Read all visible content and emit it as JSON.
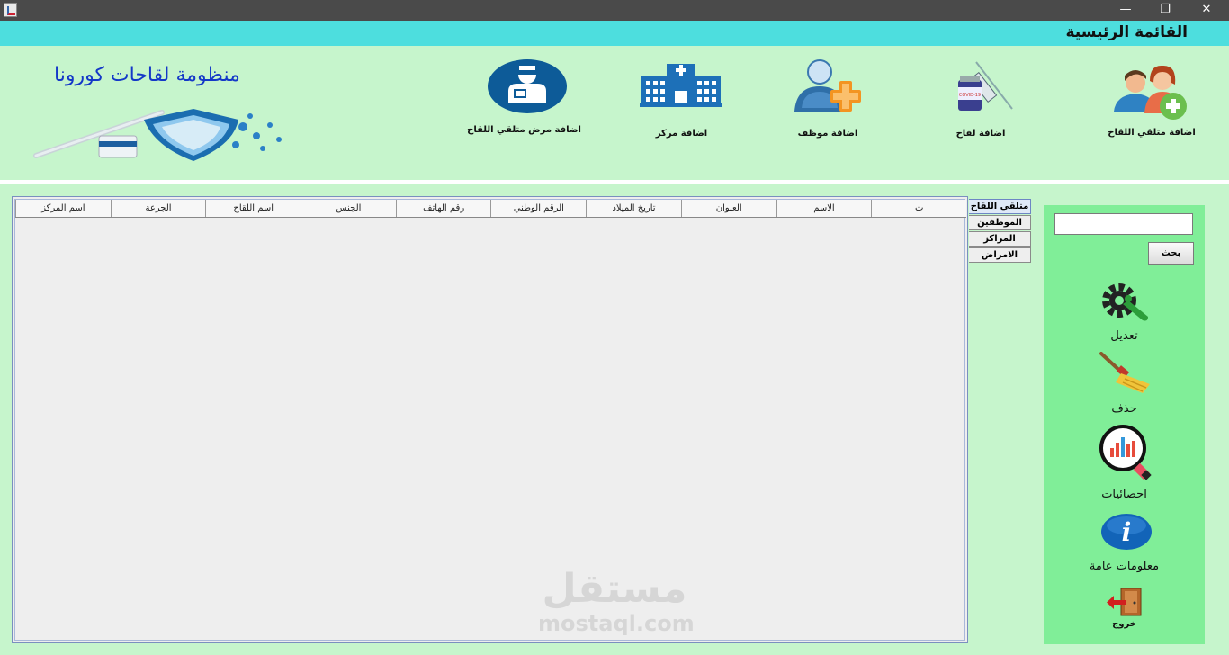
{
  "window": {
    "minimize_glyph": "—",
    "restore_glyph": "❐",
    "close_glyph": "✕"
  },
  "header": {
    "title": "القائمة الرئيسية"
  },
  "toolbar": {
    "system_title": "منظومة لقاحات كورونا",
    "items": [
      {
        "label": "اضافة متلقي اللقاح",
        "icon": "people-add-icon"
      },
      {
        "label": "اضافة لقاح",
        "icon": "vaccine-syringe-icon"
      },
      {
        "label": "اضافة موظف",
        "icon": "employee-add-icon"
      },
      {
        "label": "اضافة مركز",
        "icon": "hospital-icon"
      },
      {
        "label": "اضافة مرض متلقي اللقاح",
        "icon": "patient-icon"
      }
    ]
  },
  "table": {
    "columns": [
      "ت",
      "الاسم",
      "العنوان",
      "تاريخ الميلاد",
      "الرقم الوطني",
      "رقم الهاتف",
      "الجنس",
      "اسم اللقاح",
      "الجرعة",
      "اسم المركز"
    ],
    "rows": []
  },
  "tabs": [
    {
      "label": "متلقي اللقاح",
      "active": true
    },
    {
      "label": "الموظفين",
      "active": false
    },
    {
      "label": "المراكز",
      "active": false
    },
    {
      "label": "الامراض",
      "active": false
    }
  ],
  "sidebar": {
    "search_value": "",
    "search_button": "بحث",
    "actions": {
      "edit": "تعديل",
      "delete": "حذف",
      "stats": "احصائيات",
      "info": "معلومات عامة",
      "exit": "خروج"
    }
  },
  "watermark": {
    "brand": "مستقل",
    "domain": "mostaql.com"
  },
  "colors": {
    "accent_header": "#4ddede",
    "toolbar_bg": "#c6f5cc",
    "side_panel": "#80ee98",
    "title_blue": "#1438c8"
  }
}
